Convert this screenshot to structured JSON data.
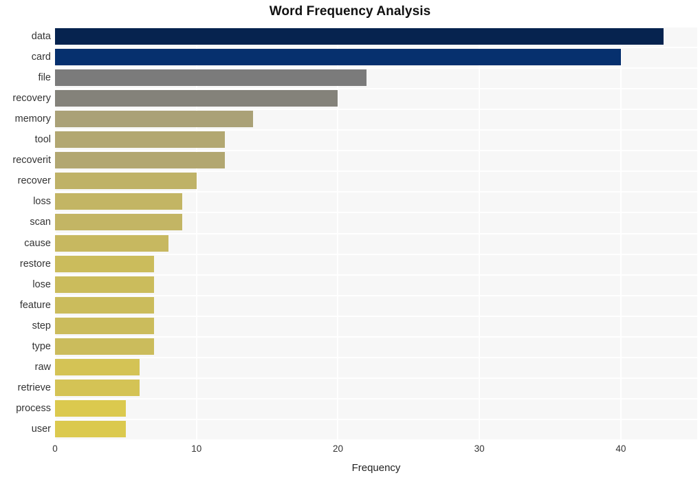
{
  "chart_data": {
    "type": "bar",
    "orientation": "horizontal",
    "title": "Word Frequency Analysis",
    "xlabel": "Frequency",
    "ylabel": "",
    "xlim": [
      0,
      45.4
    ],
    "xticks": [
      0,
      10,
      20,
      30,
      40
    ],
    "grid": true,
    "legend": null,
    "categories": [
      "data",
      "card",
      "file",
      "recovery",
      "memory",
      "tool",
      "recoverit",
      "recover",
      "loss",
      "scan",
      "cause",
      "restore",
      "lose",
      "feature",
      "step",
      "type",
      "raw",
      "retrieve",
      "process",
      "user"
    ],
    "values": [
      43,
      40,
      22,
      20,
      14,
      12,
      12,
      10,
      9,
      9,
      8,
      7,
      7,
      7,
      7,
      7,
      6,
      6,
      5,
      5
    ],
    "bar_colors": [
      "#06234f",
      "#06306e",
      "#7b7b7b",
      "#84827a",
      "#aaa177",
      "#b2a771",
      "#b2a771",
      "#bfb267",
      "#c3b564",
      "#c3b564",
      "#c7b860",
      "#cbbc5c",
      "#cbbc5c",
      "#cbbc5c",
      "#cbbc5c",
      "#cbbc5c",
      "#d4c355",
      "#d4c355",
      "#dbc94e",
      "#dbc94e"
    ],
    "plot_background": "#f7f7f7",
    "gridline_color": "#ffffff",
    "page_background": "#ffffff",
    "text_color": "#333333"
  }
}
